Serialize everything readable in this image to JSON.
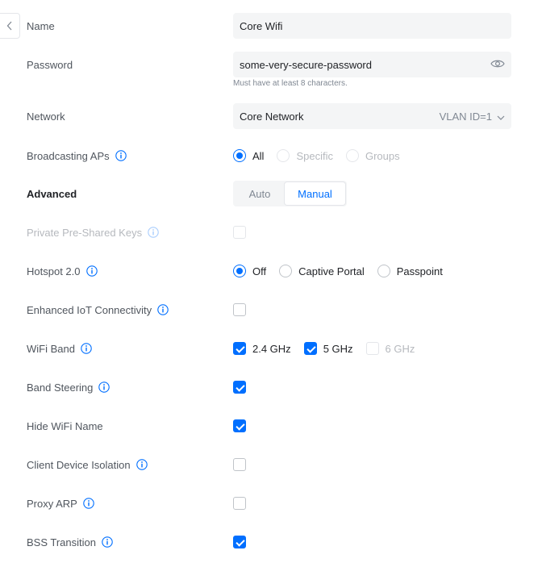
{
  "back_button": {
    "icon": "chevron-left-icon"
  },
  "name": {
    "label": "Name",
    "value": "Core Wifi"
  },
  "password": {
    "label": "Password",
    "value": "some-very-secure-password",
    "hint": "Must have at least 8 characters.",
    "icon": "eye-icon"
  },
  "network": {
    "label": "Network",
    "value": "Core Network",
    "suffix": "VLAN ID=1",
    "icon": "chevron-down-icon"
  },
  "broadcasting_aps": {
    "label": "Broadcasting APs",
    "options": [
      "All",
      "Specific",
      "Groups"
    ],
    "selected": "All"
  },
  "advanced": {
    "label": "Advanced",
    "options": [
      "Auto",
      "Manual"
    ],
    "selected": "Manual"
  },
  "private_psk": {
    "label": "Private Pre-Shared Keys",
    "checked": false,
    "disabled": true
  },
  "hotspot": {
    "label": "Hotspot 2.0",
    "options": [
      "Off",
      "Captive Portal",
      "Passpoint"
    ],
    "selected": "Off"
  },
  "iot": {
    "label": "Enhanced IoT Connectivity",
    "checked": false
  },
  "wifi_band": {
    "label": "WiFi Band",
    "bands": [
      {
        "label": "2.4 GHz",
        "checked": true
      },
      {
        "label": "5 GHz",
        "checked": true
      },
      {
        "label": "6 GHz",
        "checked": false,
        "disabled": true
      }
    ]
  },
  "band_steering": {
    "label": "Band Steering",
    "checked": true
  },
  "hide_wifi_name": {
    "label": "Hide WiFi Name",
    "checked": true
  },
  "client_isolation": {
    "label": "Client Device Isolation",
    "checked": false
  },
  "proxy_arp": {
    "label": "Proxy ARP",
    "checked": false
  },
  "bss_transition": {
    "label": "BSS Transition",
    "checked": true
  },
  "colors": {
    "accent": "#006fff",
    "text": "#50565e",
    "field_bg": "#f4f5f6",
    "disabled": "#b6b9be"
  }
}
